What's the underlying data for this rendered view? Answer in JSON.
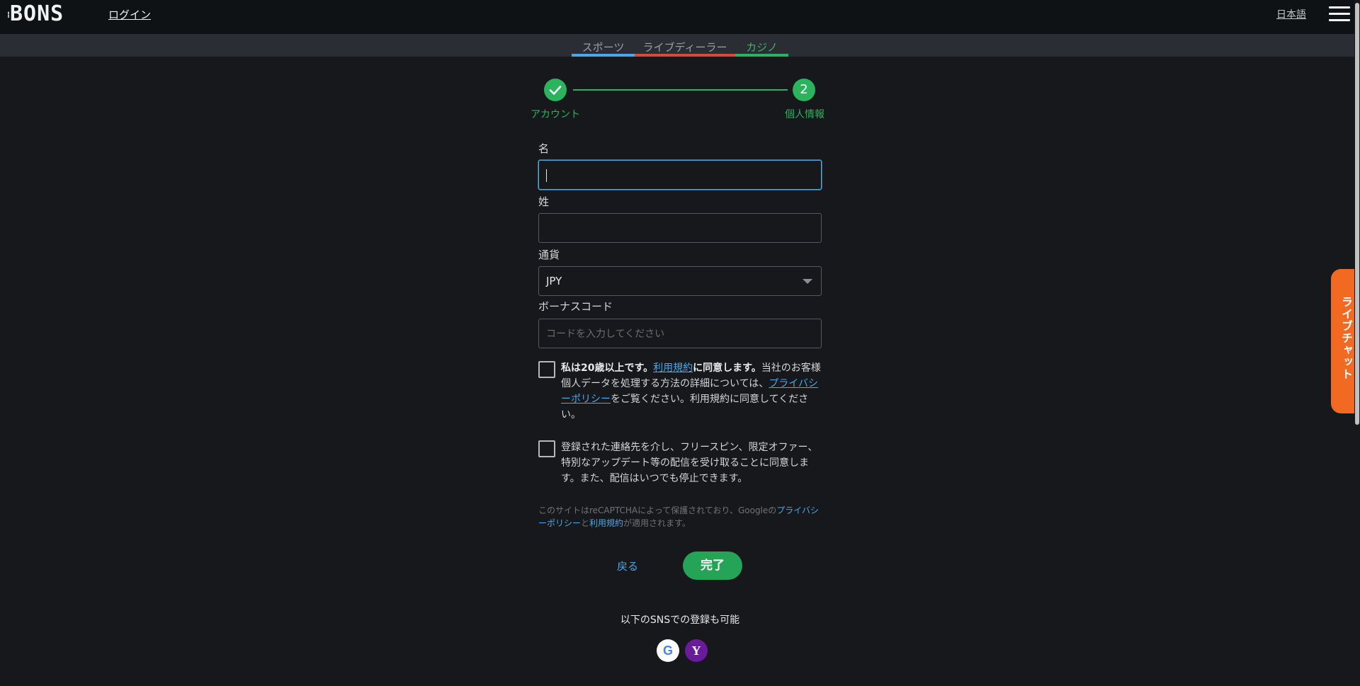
{
  "header": {
    "logo_text": "BONS",
    "login_label": "ログイン",
    "language_label": "日本語"
  },
  "tabs": [
    {
      "label": "スポーツ",
      "color": "#4aa8e8"
    },
    {
      "label": "ライブディーラー",
      "color": "#e0443f"
    },
    {
      "label": "カジノ",
      "color": "#2bb35d"
    }
  ],
  "stepper": {
    "step1_label": "アカウント",
    "step1_state": "completed",
    "step2_number": "2",
    "step2_label": "個人情報"
  },
  "form": {
    "first_name": {
      "label": "名",
      "value": ""
    },
    "last_name": {
      "label": "姓",
      "value": ""
    },
    "currency": {
      "label": "通貨",
      "value": "JPY"
    },
    "bonus_code": {
      "label": "ボーナスコード",
      "placeholder": "コードを入力してください",
      "value": ""
    },
    "age_terms": {
      "bold_prefix": "私は20歳以上です。",
      "link1": "利用規約",
      "bold_suffix": "に同意します。",
      "text1": "当社のお客様個人データを処理する方法の詳細については、",
      "link2": "プライバシーポリシー",
      "text2": "をご覧ください。利用規約に同意してください。",
      "checked": false
    },
    "marketing": {
      "text": "登録された連絡先を介し、フリースピン、限定オファー、特別なアップデート等の配信を受け取ることに同意します。また、配信はいつでも停止できます。",
      "checked": false
    },
    "recaptcha": {
      "text1": "このサイトはreCAPTCHAによって保護されており、Googleの",
      "link1": "プライバシーポリシー",
      "text2": "と",
      "link2": "利用規約",
      "text3": "が適用されます。"
    }
  },
  "actions": {
    "back_label": "戻る",
    "done_label": "完了"
  },
  "sns": {
    "label": "以下のSNSでの登録も可能",
    "google_letter": "G",
    "yahoo_letter": "Y"
  },
  "livechat": {
    "label": "ライブチャット",
    "color": "#f26a21"
  },
  "colors": {
    "accent_green": "#2bb35d",
    "link_blue": "#4aa8e8",
    "background": "#17181c"
  }
}
